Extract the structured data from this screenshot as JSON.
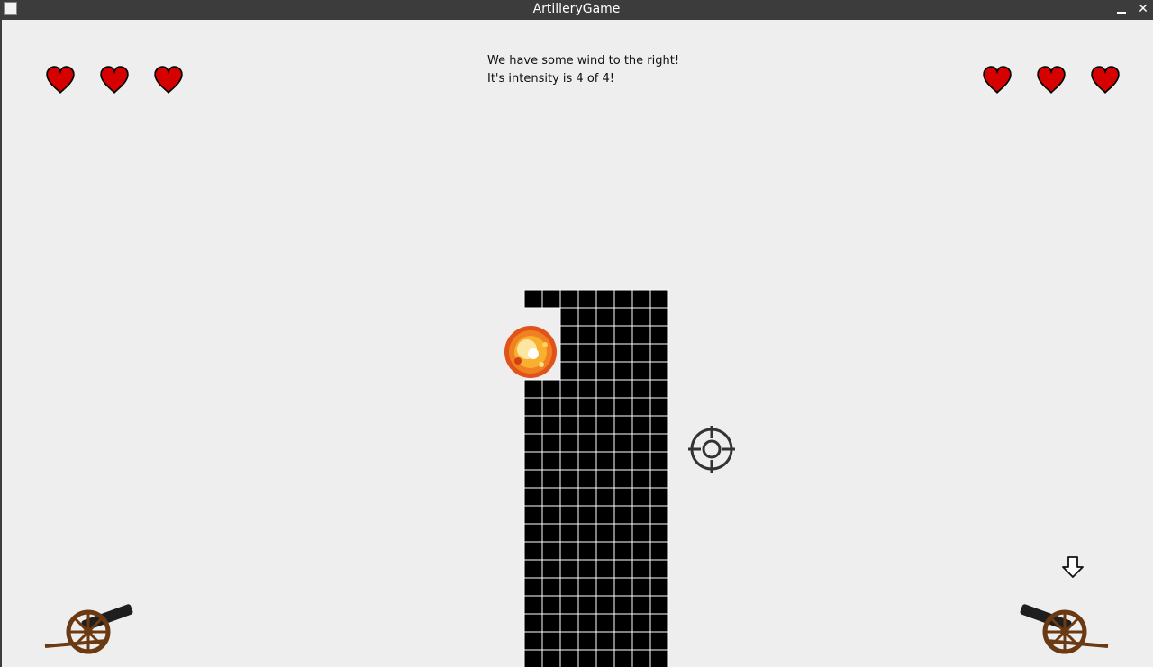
{
  "window": {
    "title": "ArtilleryGame",
    "icons": [
      "app-icon",
      "minimize-icon",
      "close-icon"
    ],
    "min_glyph": "▁",
    "close_glyph": "✕"
  },
  "hud": {
    "left_lives": 3,
    "right_lives": 3,
    "heart_color": "#d50000",
    "wind_line1": "We have some wind to the right!",
    "wind_line2": "It's intensity is 4 of 4!"
  },
  "colors": {
    "background": "#eeeeee",
    "titlebar": "#3c3c3c",
    "wall": "#000000",
    "grid": "#ffffff",
    "cannon_wood": "#6b3a12",
    "cannon_barrel": "#1e1e1e"
  },
  "scene": {
    "icons": [
      "explosion-icon",
      "crosshair-icon",
      "turn-arrow-icon",
      "left-cannon",
      "right-cannon"
    ]
  }
}
